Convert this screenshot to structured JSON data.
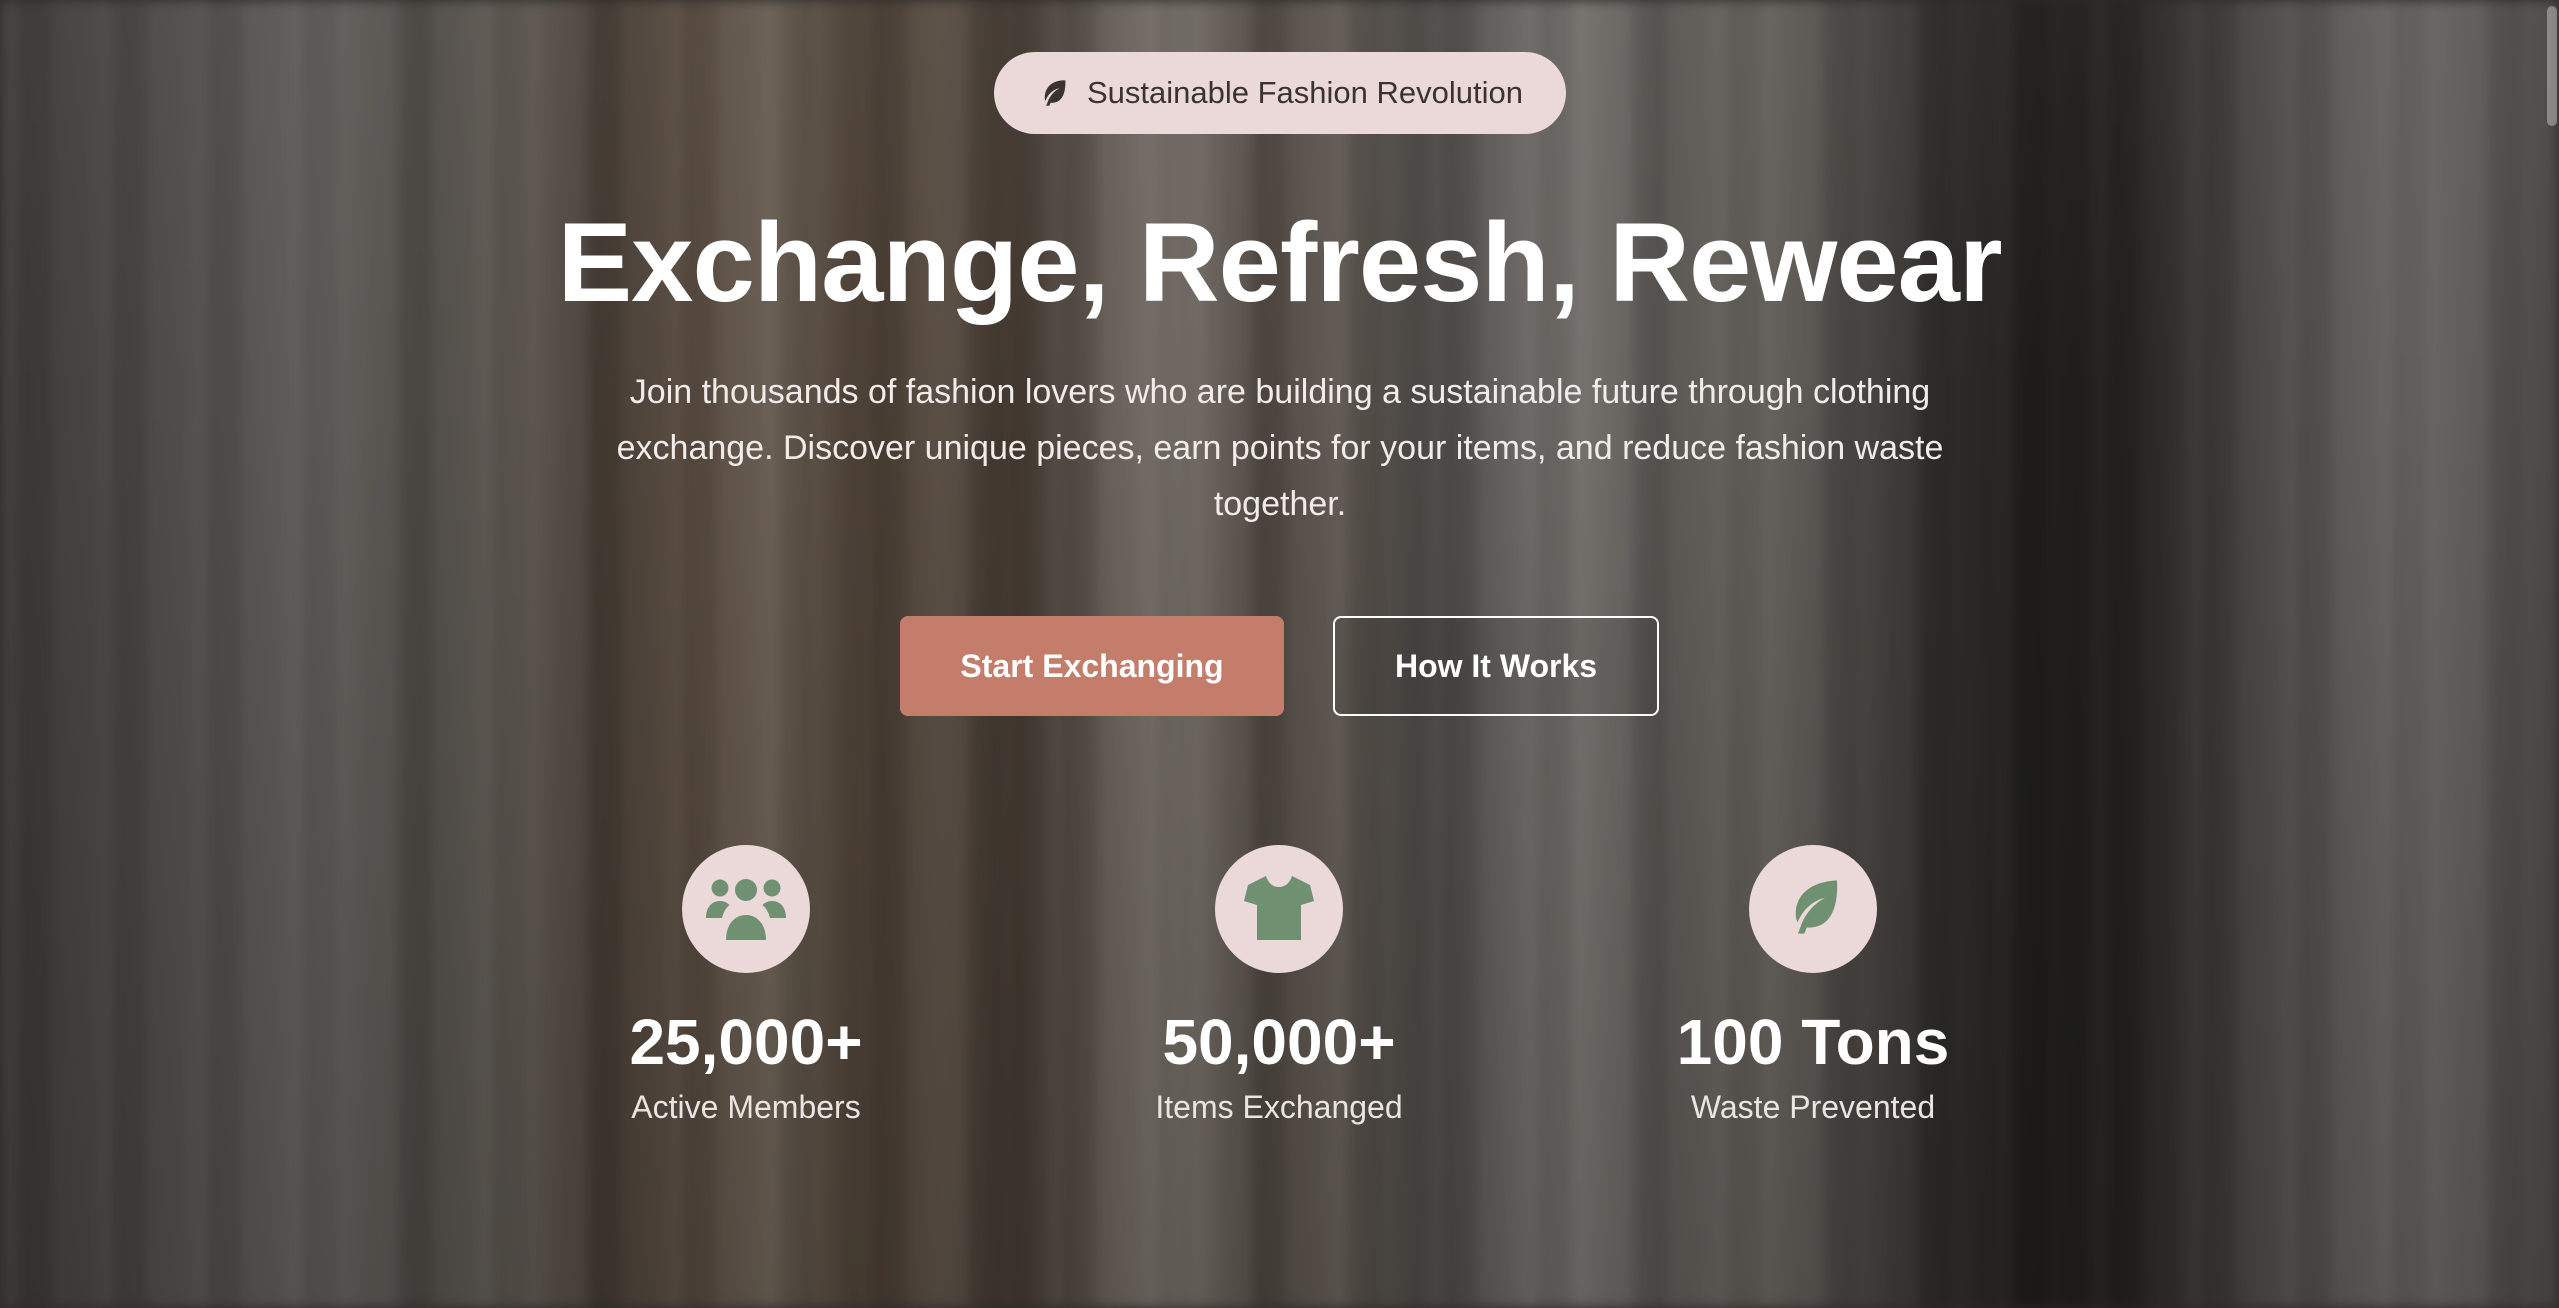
{
  "badge": {
    "icon": "leaf-icon",
    "text": "Sustainable Fashion Revolution"
  },
  "hero": {
    "title": "Exchange, Refresh, Rewear",
    "subtitle": "Join thousands of fashion lovers who are building a sustainable future through clothing exchange. Discover unique pieces, earn points for your items, and reduce fashion waste together."
  },
  "actions": {
    "primary_label": "Start Exchanging",
    "secondary_label": "How It Works"
  },
  "stats": [
    {
      "icon": "users-icon",
      "value": "25,000+",
      "label": "Active Members"
    },
    {
      "icon": "shirt-icon",
      "value": "50,000+",
      "label": "Items Exchanged"
    },
    {
      "icon": "leaf-icon",
      "value": "100 Tons",
      "label": "Waste Prevented"
    }
  ],
  "colors": {
    "accent": "#c47d6b",
    "badge_bg": "#ead9d8",
    "icon_green": "#6f9172"
  }
}
